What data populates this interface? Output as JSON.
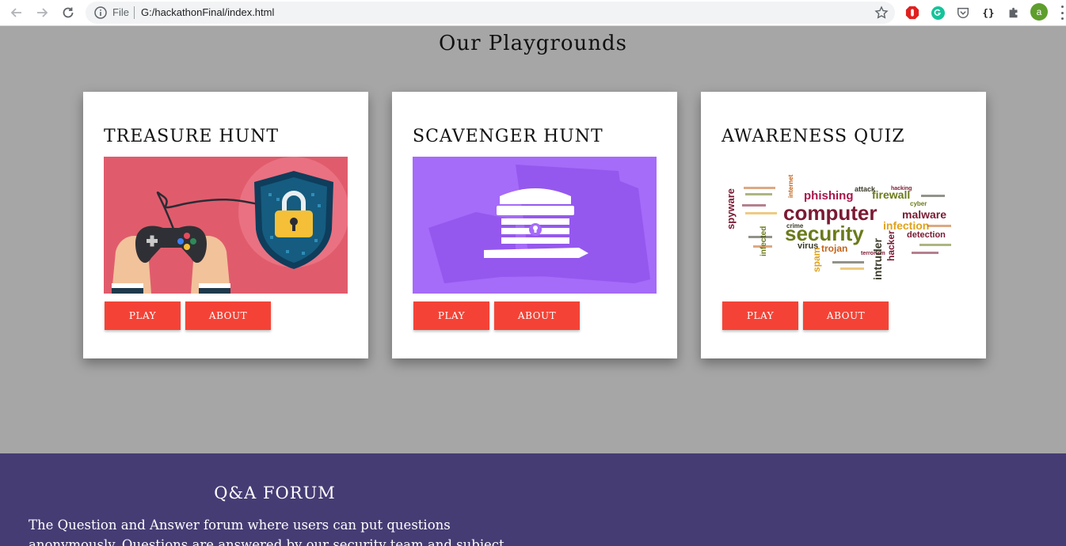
{
  "browser": {
    "file_label": "File",
    "url": "G:/hackathonFinal/index.html",
    "avatar_letter": "a",
    "extensions": [
      "adblock-icon",
      "grammarly-icon",
      "pocket-icon",
      "json-viewer-icon",
      "extensions-puzzle-icon"
    ]
  },
  "page": {
    "title": "Our Playgrounds"
  },
  "cards": [
    {
      "title": "TREASURE HUNT",
      "image": "gamepad-shield-lock-illustration",
      "play_label": "PLAY",
      "about_label": "ABOUT"
    },
    {
      "title": "SCAVENGER HUNT",
      "image": "treasure-chest-illustration",
      "play_label": "PLAY",
      "about_label": "ABOUT"
    },
    {
      "title": "AWARENESS QUIZ",
      "image": "security-word-cloud",
      "play_label": "PLAY",
      "about_label": "ABOUT"
    }
  ],
  "word_cloud": {
    "words": [
      "computer",
      "security",
      "phishing",
      "firewall",
      "malware",
      "infection",
      "detection",
      "spyware",
      "virus",
      "trojan",
      "intruder",
      "hacker",
      "spam",
      "attack",
      "hacking",
      "cyber",
      "crime",
      "infected",
      "internet",
      "terrorism"
    ]
  },
  "forum": {
    "title": "Q&A FORUM",
    "text": "The Question and Answer forum where users can put questions anonymously. Questions are answered by our security team and subject"
  },
  "colors": {
    "page_background": "#a6a6a6",
    "button": "#f44336",
    "forum_background": "#463c74",
    "card1_image_bg": "#e05c6c",
    "card2_image_bg": "#a56bf9"
  }
}
